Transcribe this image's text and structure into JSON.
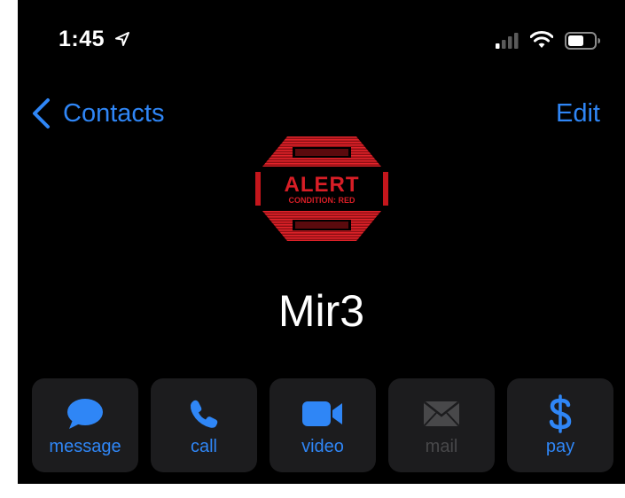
{
  "status_bar": {
    "time": "1:45"
  },
  "nav": {
    "back_label": "Contacts",
    "edit_label": "Edit"
  },
  "avatar": {
    "logo_text_main": "ALERT",
    "logo_text_sub": "CONDITION: RED"
  },
  "contact": {
    "name": "Mir3"
  },
  "actions": [
    {
      "label": "message",
      "icon": "message-bubble-icon",
      "enabled": true
    },
    {
      "label": "call",
      "icon": "phone-icon",
      "enabled": true
    },
    {
      "label": "video",
      "icon": "video-camera-icon",
      "enabled": true
    },
    {
      "label": "mail",
      "icon": "envelope-icon",
      "enabled": false
    },
    {
      "label": "pay",
      "icon": "dollar-icon",
      "enabled": true
    }
  ],
  "colors": {
    "background": "#000000",
    "accent": "#2f86f6",
    "tile": "#1c1c1e",
    "disabled": "#48484a",
    "logo_red": "#c4161c"
  }
}
